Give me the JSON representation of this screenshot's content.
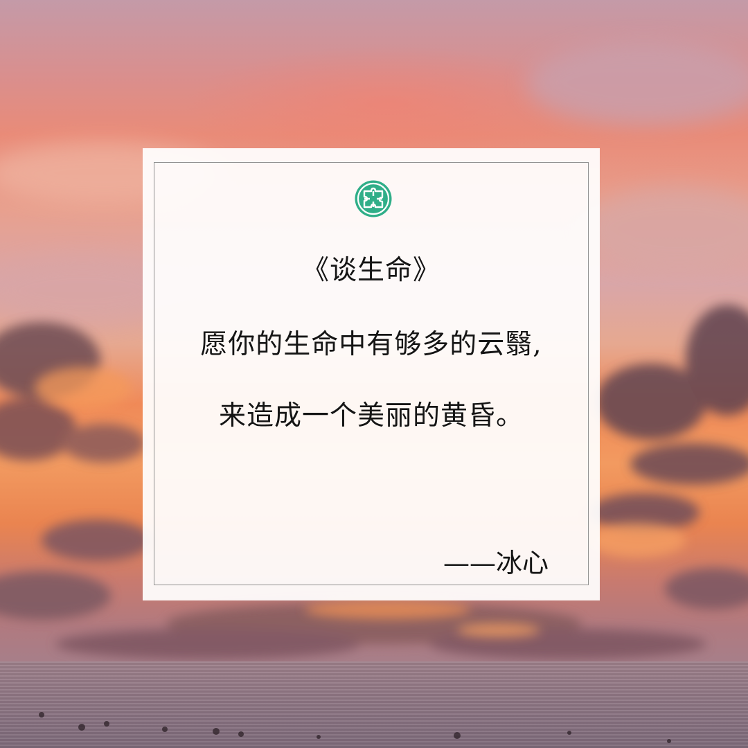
{
  "card": {
    "badge_icon": "puzzle-badge-icon",
    "title": "《谈生命》",
    "quote_line_1": "愿你的生命中有够多的云翳,",
    "quote_line_2": "来造成一个美丽的黄昏。",
    "attribution": "——冰心"
  },
  "colors": {
    "badge": "#2fae88",
    "text": "#151515"
  }
}
